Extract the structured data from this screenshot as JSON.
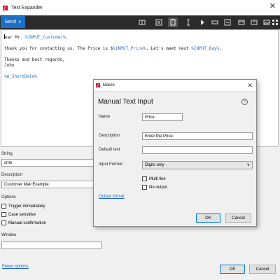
{
  "window": {
    "title": "Text Expander",
    "close_glyph": "✕"
  },
  "toolbar": {
    "send_label": "Send",
    "send_chevron": "∨",
    "tools": [
      "book-icon",
      "copy-icon",
      "clipboard-icon",
      "cursor-icon",
      "play-icon",
      "input-icon",
      "list-icon",
      "window-icon",
      "keyboard-icon",
      "image-icon",
      "grid-icon"
    ]
  },
  "editor": {
    "line1_pre": "ear Mr. ",
    "line1_var": "%INPUT_Customer%",
    "line1_post": ",",
    "line2_pre": "thank you for contacting us. The Price is $",
    "line2_var": "%INPUT_Price%",
    "line2_mid": ". Let's meet next ",
    "line2_var2": "%INPUT_Day%",
    "line2_post": ".",
    "line3": "Thanks and best regards,",
    "line4": "John",
    "line5_var": "%A_ShortDate%"
  },
  "form": {
    "string_label": "String",
    "string_value": "cme",
    "description_label": "Description",
    "description_value": "Customer Mail Example",
    "options_label": "Options",
    "options": [
      "Trigger immediately",
      "Case sensitive",
      "Manual confirmation"
    ],
    "window_label": "Window",
    "window_value": "",
    "fewer_options": "Fewer options",
    "ok": "OK",
    "cancel": "Cancel"
  },
  "dialog": {
    "title": "Macro",
    "heading": "Manual Text Input",
    "help_glyph": "?",
    "name_label": "Name",
    "name_value": "Price",
    "description_label": "Description",
    "description_value": "Enter the Price:",
    "default_label": "Default text",
    "default_value": "",
    "format_label": "Input Format",
    "format_value": "Digits only",
    "multiline": "Multi line",
    "no_output": "No output",
    "output_format": "Output format",
    "ok": "OK",
    "cancel": "Cancel"
  },
  "colors": {
    "accent": "#1d6fc4",
    "toolbar": "#2b2b2b",
    "variable": "#1b6fbf",
    "brand": "#c8102e"
  }
}
